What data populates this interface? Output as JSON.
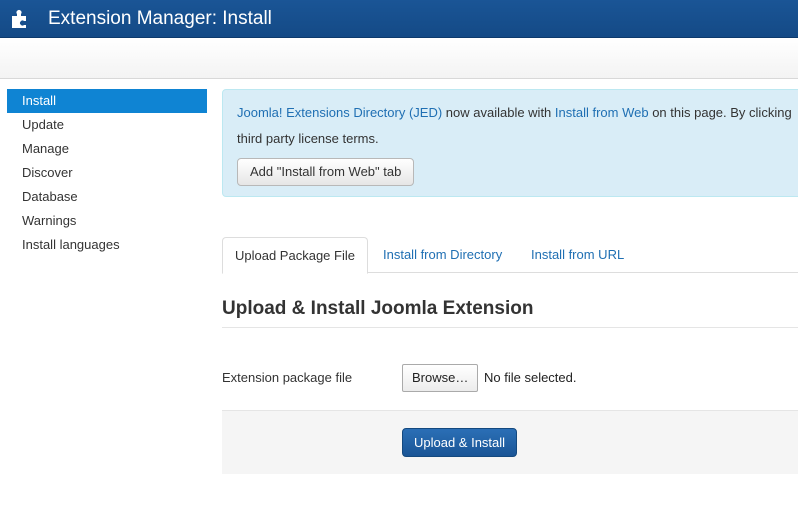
{
  "header": {
    "title": "Extension Manager: Install",
    "icon": "puzzle-icon"
  },
  "sidebar": {
    "items": [
      {
        "label": "Install",
        "active": true
      },
      {
        "label": "Update"
      },
      {
        "label": "Manage"
      },
      {
        "label": "Discover"
      },
      {
        "label": "Database"
      },
      {
        "label": "Warnings"
      },
      {
        "label": "Install languages"
      }
    ]
  },
  "alert": {
    "link1": "Joomla! Extensions Directory (JED)",
    "text1": " now available with ",
    "link2": "Install from Web",
    "text2": " on this page.  By clicking",
    "line2": "third party license terms.",
    "button": "Add \"Install from Web\" tab"
  },
  "tabs": [
    {
      "label": "Upload Package File",
      "active": true
    },
    {
      "label": "Install from Directory"
    },
    {
      "label": "Install from URL"
    }
  ],
  "section": {
    "title": "Upload & Install Joomla Extension"
  },
  "form": {
    "label": "Extension package file",
    "browse": "Browse…",
    "status": "No file selected.",
    "submit": "Upload & Install"
  },
  "colors": {
    "header": "#1a5596",
    "active_nav": "#0f84d3",
    "link": "#1f6fb3",
    "alert_bg": "#d9edf7"
  }
}
